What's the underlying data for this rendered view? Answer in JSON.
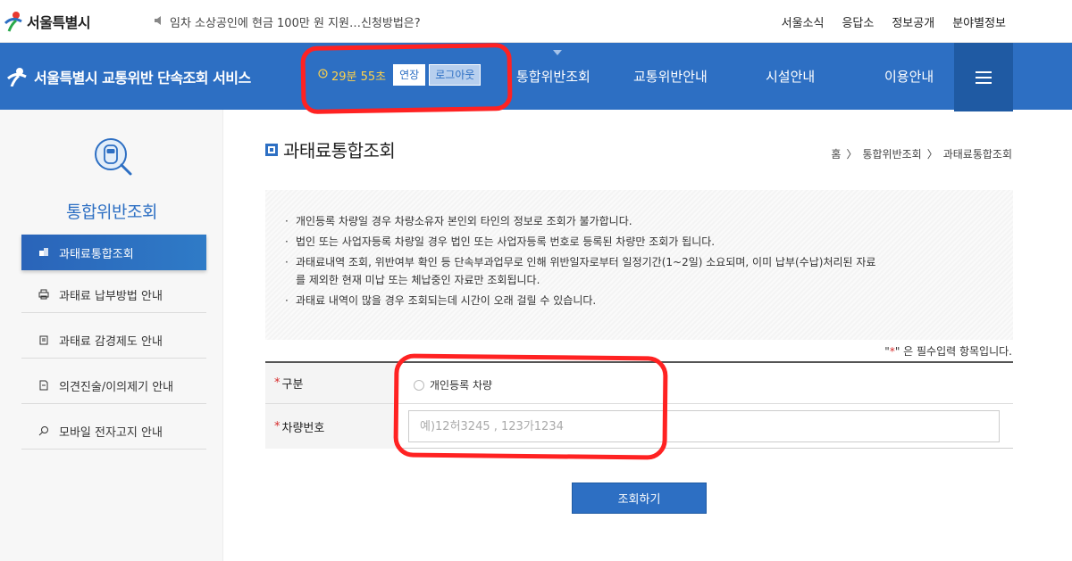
{
  "topbar": {
    "logo_text": "서울특별시",
    "notice": "임차 소상공인에 현금 100만 원 지원…신청방법은?",
    "links": [
      "서울소식",
      "응답소",
      "정보공개",
      "분야별정보"
    ]
  },
  "nav": {
    "site_title": "서울특별시 교통위반 단속조회 서비스",
    "timer": "29분 55초",
    "extend_label": "연장",
    "logout_label": "로그아웃",
    "menu": [
      "통합위반조회",
      "교통위반안내",
      "시설안내",
      "이용안내"
    ]
  },
  "sidebar": {
    "title": "통합위반조회",
    "items": [
      {
        "label": "과태료통합조회",
        "icon": "coins-icon"
      },
      {
        "label": "과태료 납부방법 안내",
        "icon": "printer-icon"
      },
      {
        "label": "과태료 감경제도 안내",
        "icon": "clipboard-icon"
      },
      {
        "label": "의견진술/이의제기 안내",
        "icon": "document-icon"
      },
      {
        "label": "모바일 전자고지 안내",
        "icon": "search-icon"
      }
    ]
  },
  "main": {
    "page_title": "과태료통합조회",
    "breadcrumb": [
      "홈",
      "통합위반조회",
      "과태료통합조회"
    ],
    "notices": [
      "개인등록 차량일 경우 차량소유자 본인외 타인의 정보로 조회가 불가합니다.",
      "법인 또는 사업자등록 차량일 경우 법인 또는 사업자등록 번호로 등록된 차량만 조회가 됩니다.",
      "과태료내역 조회, 위반여부 확인 등 단속부과업무로 인해 위반일자로부터 일정기간(1~2일) 소요되며, 이미 납부(수납)처리된 자료",
      "를 제외한 현재 미납 또는 체납중인 자료만 조회됩니다.",
      "과태료 내역이 많을 경우 조회되는데 시간이 오래 걸릴 수 있습니다."
    ],
    "required_note_prefix": "\"",
    "required_note_star": "*",
    "required_note_suffix": "\" 은 필수입력 항목입니다.",
    "form": {
      "category_label": "구분",
      "category_option": "개인등록 차량",
      "car_number_label": "차량번호",
      "car_number_placeholder": "예)12허3245 , 123가1234",
      "car_number_value": ""
    },
    "submit_label": "조회하기"
  },
  "colors": {
    "brand_blue": "#2d6fc3",
    "timer_yellow": "#ffd24a",
    "annotation_red": "#ff2222"
  }
}
